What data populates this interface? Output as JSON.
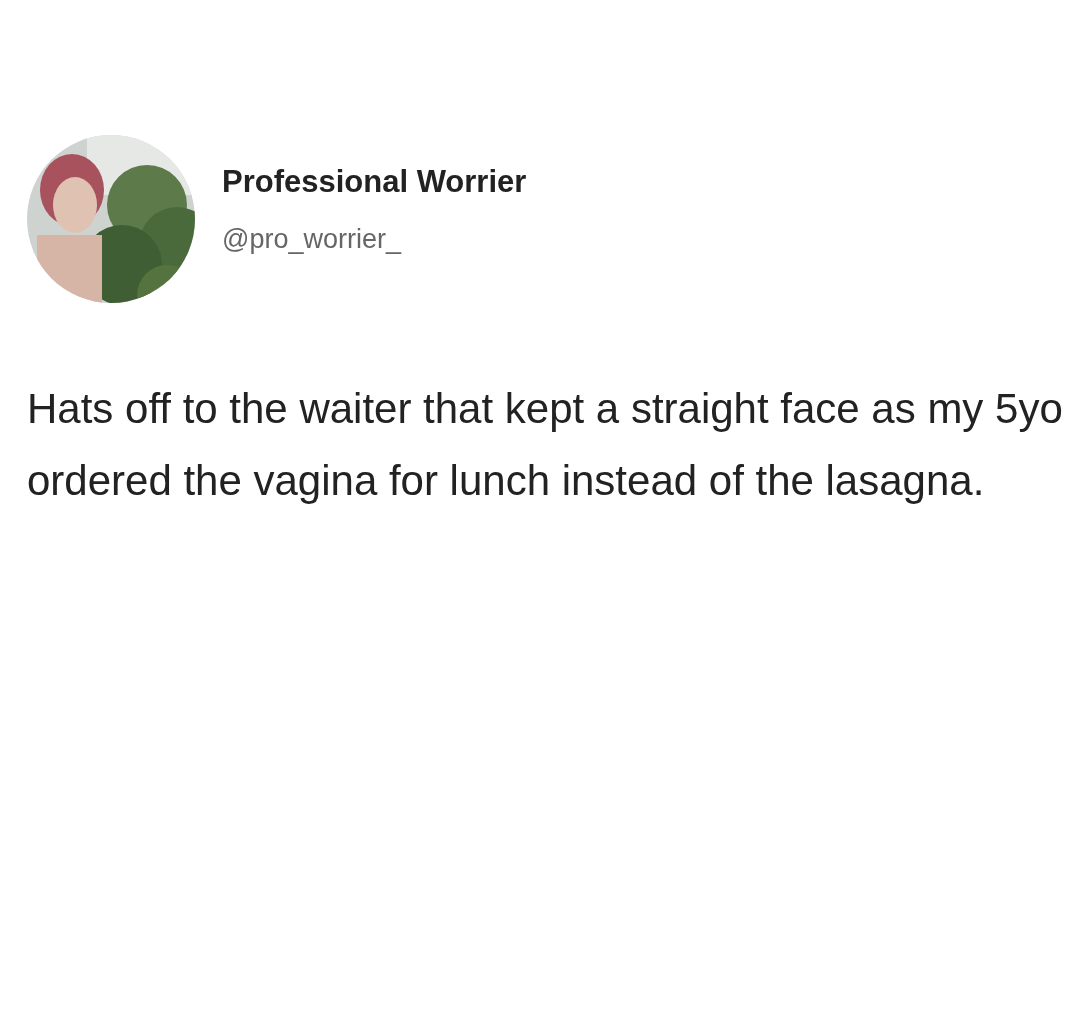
{
  "tweet": {
    "author": {
      "name": "Professional Worrier",
      "handle": "@pro_worrier_"
    },
    "text": "Hats off to the waiter that kept a straight face as my 5yo ordered the vagina for lunch instead of the lasagna."
  }
}
